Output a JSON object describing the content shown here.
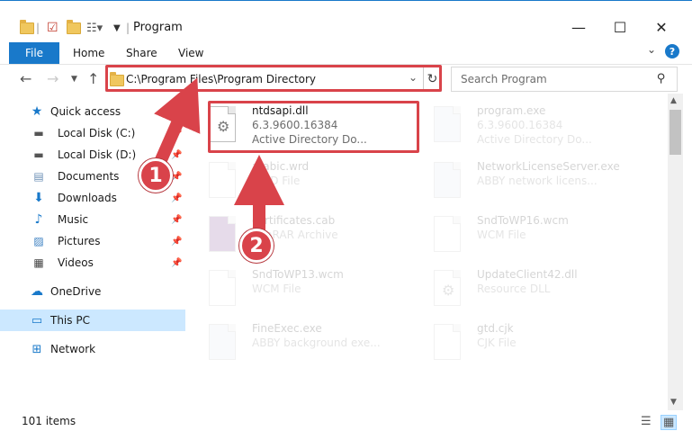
{
  "window": {
    "title": "Program",
    "minimize_glyph": "—",
    "maximize_glyph": "☐",
    "close_glyph": "✕"
  },
  "ribbon": {
    "file": "File",
    "home": "Home",
    "share": "Share",
    "view": "View",
    "help": "?"
  },
  "nav": {
    "address": "C:\\Program Files\\Program Directory",
    "search_placeholder": "Search Program"
  },
  "sidebar": {
    "items": [
      {
        "label": "Quick access",
        "icon": "star-icon"
      },
      {
        "label": "Local Disk (C:)",
        "icon": "drive-icon"
      },
      {
        "label": "Local Disk (D:)",
        "icon": "drive-icon"
      },
      {
        "label": "Documents",
        "icon": "documents-icon"
      },
      {
        "label": "Downloads",
        "icon": "downloads-icon"
      },
      {
        "label": "Music",
        "icon": "music-icon"
      },
      {
        "label": "Pictures",
        "icon": "pictures-icon"
      },
      {
        "label": "Videos",
        "icon": "videos-icon"
      },
      {
        "label": "OneDrive",
        "icon": "cloud-icon"
      },
      {
        "label": "This PC",
        "icon": "computer-icon"
      },
      {
        "label": "Network",
        "icon": "network-icon"
      }
    ]
  },
  "files": [
    {
      "name": "ntdsapi.dll",
      "meta1": "6.3.9600.16384",
      "meta2": "Active Directory Do..."
    },
    {
      "name": "program.exe",
      "meta1": "6.3.9600.16384",
      "meta2": "Active Directory Do..."
    },
    {
      "name": "arabic.wrd",
      "meta1": "WRD File",
      "meta2": ""
    },
    {
      "name": "NetworkLicenseServer.exe",
      "meta1": "ABBY network licens...",
      "meta2": ""
    },
    {
      "name": "certificates.cab",
      "meta1": "WinRAR Archive",
      "meta2": ""
    },
    {
      "name": "SndToWP16.wcm",
      "meta1": "WCM File",
      "meta2": ""
    },
    {
      "name": "SndToWP13.wcm",
      "meta1": "WCM File",
      "meta2": ""
    },
    {
      "name": "UpdateClient42.dll",
      "meta1": "Resource DLL",
      "meta2": ""
    },
    {
      "name": "FineExec.exe",
      "meta1": "ABBY background exe...",
      "meta2": ""
    },
    {
      "name": "gtd.cjk",
      "meta1": "CJK File",
      "meta2": ""
    }
  ],
  "status": {
    "count": "101 items"
  },
  "annotations": {
    "badge1": "1",
    "badge2": "2"
  },
  "colors": {
    "accent": "#1979ca",
    "annotation_red": "#d9434a",
    "selected_bg": "#cce8ff"
  }
}
